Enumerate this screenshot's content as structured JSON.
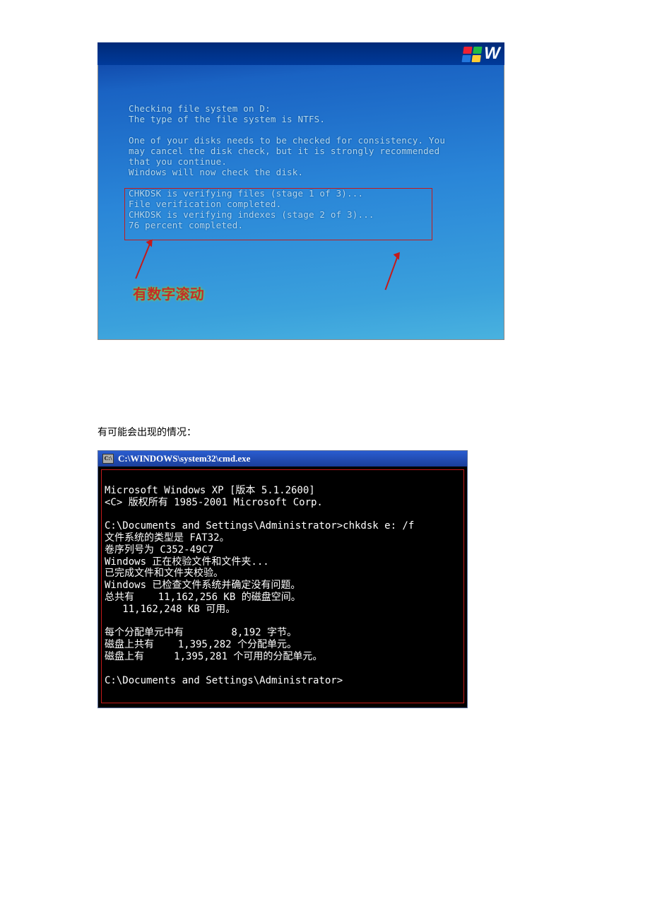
{
  "chkdsk": {
    "logo_w": "W",
    "l1": "Checking file system on D:",
    "l2": "The type of the file system is NTFS.",
    "p2a": "One of your disks needs to be checked for consistency. You",
    "p2b": "may cancel the disk check, but it is strongly recommended",
    "p2c": "that you continue.",
    "p2d": "Windows will now check the disk.",
    "s1": "CHKDSK is verifying files (stage 1 of 3)...",
    "s2": "File verification completed.",
    "s3": "CHKDSK is verifying indexes (stage 2 of 3)...",
    "s4": "76 percent completed.",
    "annotation": "有数字滚动"
  },
  "caption": "有可能会出现的情况：",
  "cmd": {
    "title": "C:\\WINDOWS\\system32\\cmd.exe",
    "ico": "C:\\",
    "l1": "Microsoft Windows XP [版本 5.1.2600]",
    "l2": "<C> 版权所有 1985-2001 Microsoft Corp.",
    "blank1": " ",
    "l3": "C:\\Documents and Settings\\Administrator>chkdsk e: /f",
    "l4": "文件系统的类型是 FAT32。",
    "l5": "卷序列号为 C352-49C7",
    "l6": "Windows 正在校验文件和文件夹...",
    "l7": "已完成文件和文件夹校验。",
    "l8": "Windows 已检查文件系统并确定没有问题。",
    "l9": "总共有    11,162,256 KB 的磁盘空间。",
    "l10": "   11,162,248 KB 可用。",
    "blank2": " ",
    "l11": "每个分配单元中有        8,192 字节。",
    "l12": "磁盘上共有    1,395,282 个分配单元。",
    "l13": "磁盘上有     1,395,281 个可用的分配单元。",
    "blank3": " ",
    "l14": "C:\\Documents and Settings\\Administrator>"
  }
}
